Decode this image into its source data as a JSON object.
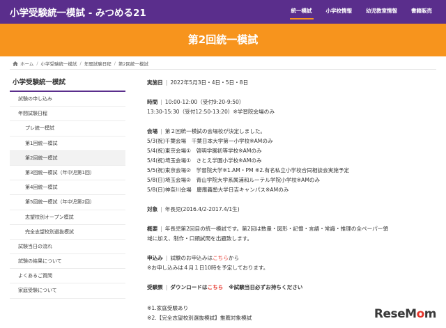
{
  "header": {
    "site_title": "小学受験統一模試 - みつめる21",
    "nav": [
      "統一模試",
      "小学校情報",
      "幼児教室情報",
      "書籍販売"
    ]
  },
  "hero": {
    "title": "第2回統一模試"
  },
  "breadcrumb": [
    "ホーム",
    "小学受験統一模試",
    "年間試験日程",
    "第2回統一模試"
  ],
  "sidebar": {
    "heading": "小学受験統一模試",
    "items": [
      "試験の申し込み",
      "年間試験日程",
      "プレ統一模試",
      "第1回統一模試",
      "第2回統一模試",
      "第3回統一模試（年中児第1回）",
      "第4回統一模試",
      "第5回統一模試（年中児第2回）",
      "志望校別オープン模試",
      "完全志望校別選抜模試",
      "試験当日の流れ",
      "試験の結果について",
      "よくあるご質問",
      "家庭受験について"
    ]
  },
  "content": {
    "date_label": "実施日",
    "date_value": "2022年5月3日・4日・5日・8日",
    "time_label": "時間",
    "time_line1": "10:00-12:00（受付9:20-9:50）",
    "time_line2": "13:30-15:30（受付12:50-13:20）※学習院会場のみ",
    "venue_label": "会場",
    "venue_intro": "第２回統一模試の会場校が決定しました。",
    "venues": [
      "5/3(祝)千葉会場　千葉日本大学第一小学校※AMのみ",
      "5/4(祝)東京会場①　啓明学園初等学校※AMのみ",
      "5/4(祝)埼玉会場①　さとえ学園小学校※AMのみ",
      "5/5(祝)東京会場②　学習院大学※1.AM・PM ※2.有名私立小学校合同相談会実施予定",
      "5/8(日)埼玉会場②　青山学院大学系属浦和ルーテル学院小学校※AMのみ",
      "5/8(日)神奈川会場　慶應義塾大学日吉キャンパス※AMのみ"
    ],
    "target_label": "対象",
    "target_value": "年長児(2016.4/2-2017.4/1生)",
    "overview_label": "概要",
    "overview_line1": "年長児第2回目の統一模試です。第2回は数量・図形・記憶・言語・常識・推理の全ペーパー領",
    "overview_line2": "域に加え、制作・口頭試問を出題致します。",
    "apply_label": "申込み",
    "apply_text": "試験のお申込みは",
    "apply_link": "こちら",
    "apply_suffix": "から",
    "apply_note": "※お申し込みは４月１日10時を予定しております。",
    "ticket_label": "受験票",
    "ticket_text": "ダウンロードは",
    "ticket_link": "こちら",
    "ticket_note": "※試験当日必ずお持ちください",
    "note1": "※1.家庭受験あり",
    "note2": "※2.【完全志望校別選抜模試】推薦対象模試"
  },
  "logo": {
    "prefix": "ReseM",
    "o": "o",
    "suffix": "m"
  },
  "icons": {
    "home": "home-icon"
  },
  "colors": {
    "header": "#5a2e8c",
    "hero": "#f7941d",
    "link": "#e6352b"
  }
}
